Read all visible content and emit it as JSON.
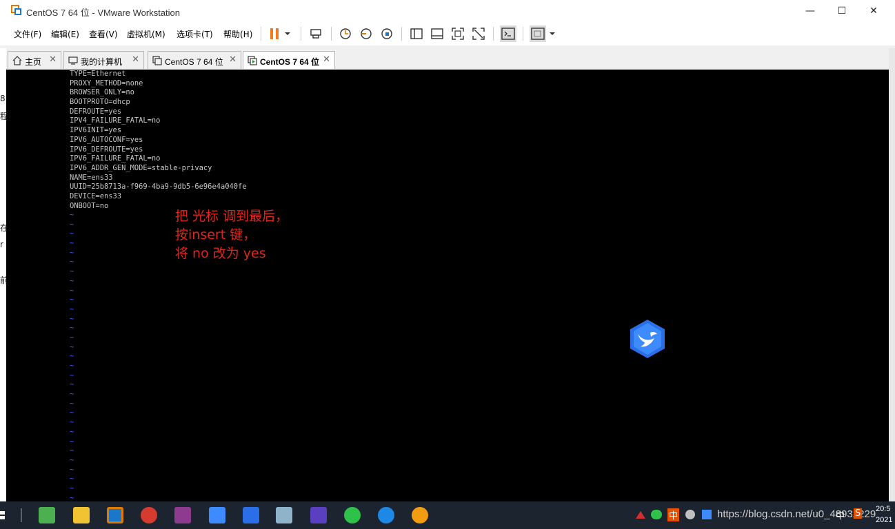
{
  "window": {
    "title": "CentOS 7 64 位 - VMware Workstation",
    "minimize": "—",
    "maximize": "☐",
    "close": "✕"
  },
  "menu": [
    {
      "label": "文件(F)"
    },
    {
      "label": "编辑(E)"
    },
    {
      "label": "查看(V)"
    },
    {
      "label": "虚拟机(M)"
    },
    {
      "label": "选项卡(T)"
    },
    {
      "label": "帮助(H)"
    }
  ],
  "tabs": [
    {
      "label": "主页",
      "close": "✕"
    },
    {
      "label": "我的计算机",
      "close": "✕"
    },
    {
      "label": "CentOS 7 64 位",
      "close": "✕"
    },
    {
      "label": "CentOS 7 64 位",
      "close": "✕"
    }
  ],
  "left_strip": [
    "8",
    "程",
    "在",
    "r",
    "前"
  ],
  "terminal": {
    "lines": [
      "TYPE=Ethernet",
      "PROXY_METHOD=none",
      "BROWSER_ONLY=no",
      "BOOTPROTO=dhcp",
      "DEFROUTE=yes",
      "IPV4_FAILURE_FATAL=no",
      "IPV6INIT=yes",
      "IPV6_AUTOCONF=yes",
      "IPV6_DEFROUTE=yes",
      "IPV6_FAILURE_FATAL=no",
      "IPV6_ADDR_GEN_MODE=stable-privacy",
      "NAME=ens33",
      "UUID=25b8713a-f969-4ba9-9db5-6e96e4a040fe",
      "DEVICE=ens33",
      "ONBOOT=no"
    ],
    "tilde": "~",
    "tilde_count": 31
  },
  "annotation": {
    "line1": "把 光标 调到最后，",
    "line2": "按insert 键，",
    "line3": "将 no 改为 yes"
  },
  "taskbar": {
    "tray": {
      "ime1": "中",
      "ime2": "中",
      "ime3": "S"
    },
    "watermark": "https://blog.csdn.net/u0_48932229",
    "clock_time": "20:5",
    "clock_date": "2021"
  },
  "colors": {
    "console_bg": "#000000",
    "terminal_text": "#c8c8c8",
    "tilde": "#4a5cff",
    "annotation": "#e0261c",
    "pause_icon": "#f07c1e",
    "taskbar": "#1c2430"
  }
}
